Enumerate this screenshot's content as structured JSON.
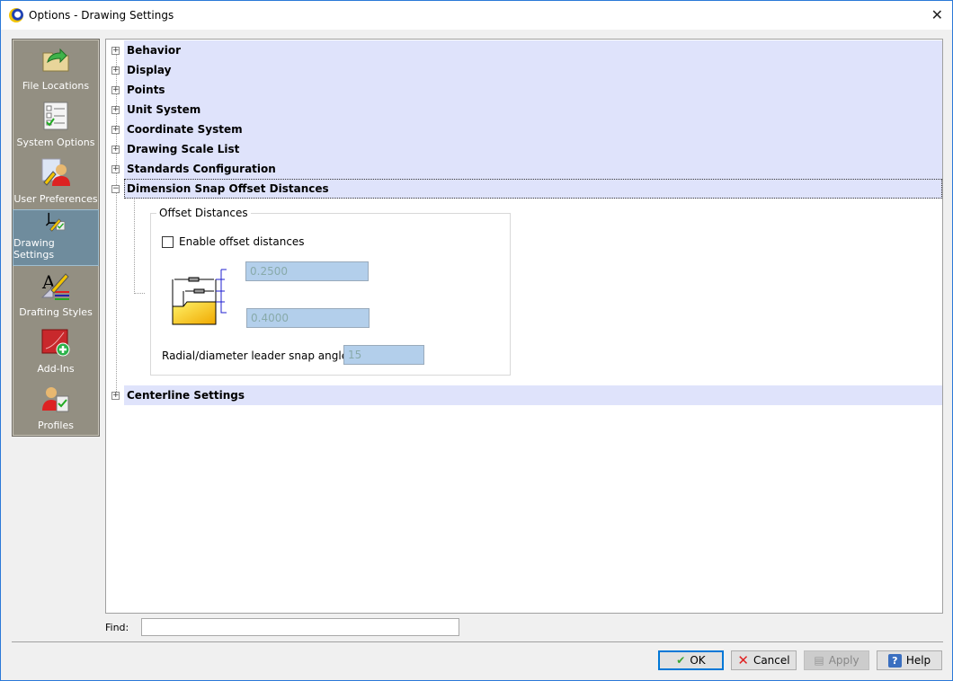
{
  "window": {
    "title": "Options - Drawing Settings"
  },
  "sidebar": {
    "items": [
      {
        "label": "File Locations",
        "icon": "folder-arrow-icon"
      },
      {
        "label": "System Options",
        "icon": "checklist-icon"
      },
      {
        "label": "User Preferences",
        "icon": "user-pencil-icon"
      },
      {
        "label": "Drawing Settings",
        "icon": "axes-pencil-icon",
        "selected": true
      },
      {
        "label": "Drafting Styles",
        "icon": "text-style-icon"
      },
      {
        "label": "Add-Ins",
        "icon": "addin-plus-icon"
      },
      {
        "label": "Profiles",
        "icon": "profile-icon"
      }
    ]
  },
  "tree": {
    "items": [
      {
        "label": "Behavior",
        "expanded": false
      },
      {
        "label": "Display",
        "expanded": false
      },
      {
        "label": "Points",
        "expanded": false
      },
      {
        "label": "Unit System",
        "expanded": false
      },
      {
        "label": "Coordinate System",
        "expanded": false
      },
      {
        "label": "Drawing Scale List",
        "expanded": false
      },
      {
        "label": "Standards Configuration",
        "expanded": false
      },
      {
        "label": "Dimension Snap Offset Distances",
        "expanded": true
      },
      {
        "label": "Centerline Settings",
        "expanded": false
      }
    ]
  },
  "offset": {
    "group_title": "Offset Distances",
    "enable_label": "Enable offset distances",
    "enabled": false,
    "first_value": "0.2500",
    "second_value": "0.4000",
    "snap_label": "Radial/diameter leader snap angle:",
    "snap_value": "15"
  },
  "find": {
    "label": "Find:",
    "value": ""
  },
  "buttons": {
    "ok": "OK",
    "cancel": "Cancel",
    "apply": "Apply",
    "help": "Help"
  },
  "colors": {
    "band": "#dfe3fb",
    "sidebar": "#938f82",
    "selected": "#6f8c9d",
    "field": "#b3cfeb"
  }
}
